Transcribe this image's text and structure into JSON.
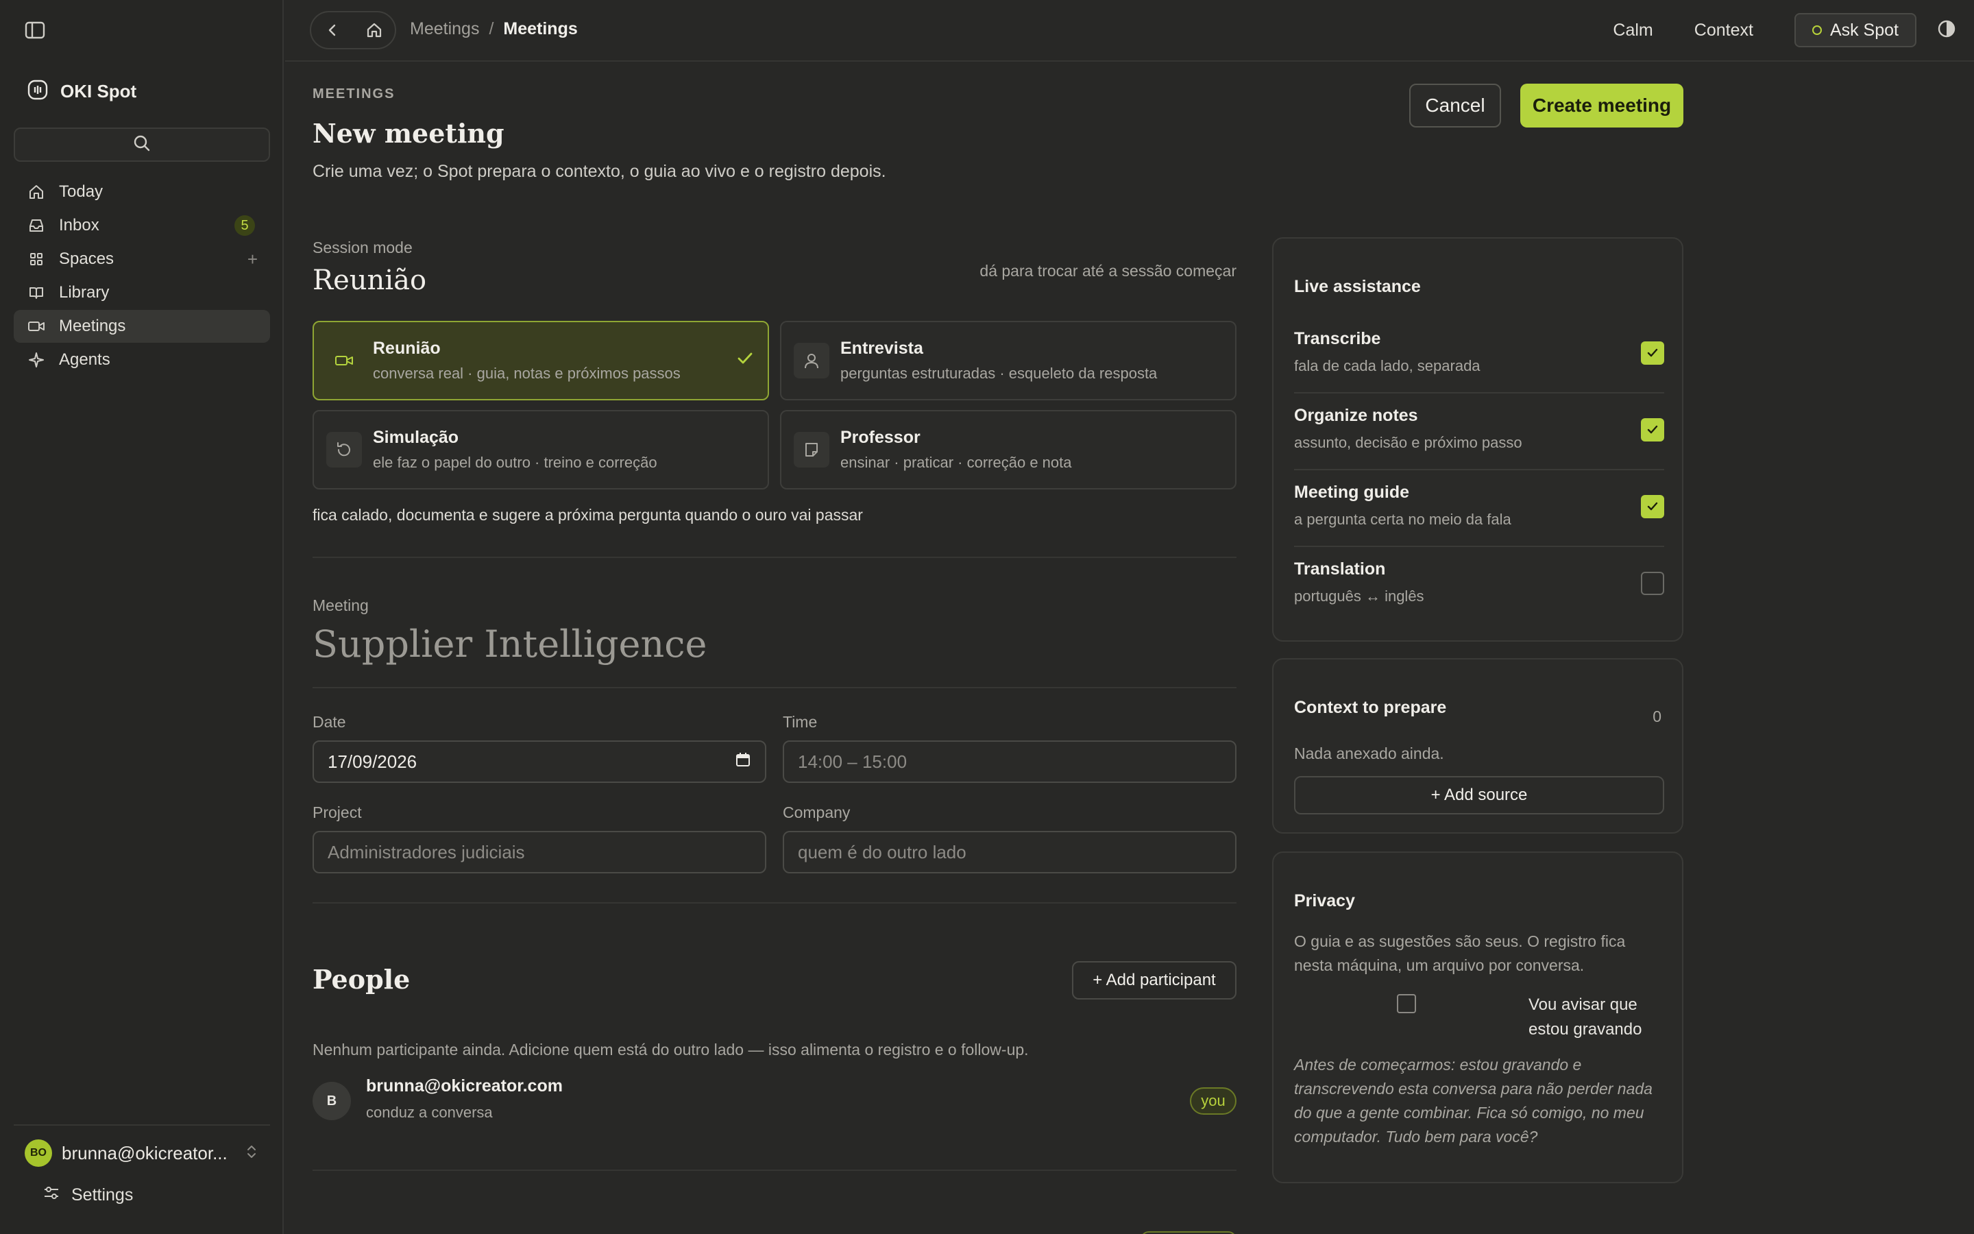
{
  "app": {
    "name": "OKI Spot"
  },
  "sidebar": {
    "search_placeholder": "",
    "items": [
      {
        "label": "Today",
        "icon": "home-icon"
      },
      {
        "label": "Inbox",
        "icon": "inbox-icon",
        "count": "5"
      },
      {
        "label": "Spaces",
        "icon": "grid-icon"
      },
      {
        "label": "Library",
        "icon": "book-icon"
      },
      {
        "label": "Meetings",
        "icon": "video-icon",
        "active": true
      },
      {
        "label": "Agents",
        "icon": "sparkle-icon"
      }
    ],
    "account": {
      "initials": "BO",
      "name": "brunna@okicreator..."
    },
    "settings_label": "Settings"
  },
  "topbar": {
    "breadcrumb": [
      "Meetings",
      "Meetings"
    ],
    "separator": "/",
    "links": [
      "Calm",
      "Context"
    ],
    "ask_label": "Ask Spot"
  },
  "page": {
    "kicker": "MEETINGS",
    "title": "New meeting",
    "subtitle": "Crie uma vez; o Spot prepara o contexto, o guia ao vivo e o registro depois.",
    "cancel_label": "Cancel",
    "create_label": "Create meeting"
  },
  "session": {
    "label": "Session mode",
    "current": "Reunião",
    "hint": "dá para trocar até a sessão começar",
    "modes": [
      {
        "name": "Reunião",
        "desc": "conversa real · guia, notas e próximos passos",
        "icon": "video-icon",
        "selected": true
      },
      {
        "name": "Entrevista",
        "desc": "perguntas estruturadas · esqueleto da resposta",
        "icon": "person-icon",
        "selected": false
      },
      {
        "name": "Simulação",
        "desc": "ele faz o papel do outro · treino e correção",
        "icon": "rotate-icon",
        "selected": false
      },
      {
        "name": "Professor",
        "desc": "ensinar · praticar · correção e nota",
        "icon": "note-icon",
        "selected": false
      }
    ],
    "note": "fica calado, documenta e sugere a próxima pergunta quando o ouro vai passar"
  },
  "meeting": {
    "label": "Meeting",
    "name_placeholder": "Supplier Intelligence",
    "date_label": "Date",
    "date_value": "17/09/2026",
    "time_label": "Time",
    "time_placeholder": "14:00 – 15:00",
    "project_label": "Project",
    "project_placeholder": "Administradores judiciais",
    "company_label": "Company",
    "company_placeholder": "quem é do outro lado"
  },
  "people": {
    "title": "People",
    "add_label": "+ Add participant",
    "empty_text": "Nenhum participante ainda. Adicione quem está do outro lado — isso alimenta o registro e o follow-up.",
    "participants": [
      {
        "initial": "B",
        "email": "brunna@okicreator.com",
        "role": "conduz a conversa",
        "badge": "you"
      }
    ]
  },
  "live_assistance": {
    "title": "Live assistance",
    "items": [
      {
        "name": "Transcribe",
        "desc": "fala de cada lado, separada",
        "checked": true
      },
      {
        "name": "Organize notes",
        "desc": "assunto, decisão e próximo passo",
        "checked": true
      },
      {
        "name": "Meeting guide",
        "desc": "a pergunta certa no meio da fala",
        "checked": true
      },
      {
        "name": "Translation",
        "desc": "português ↔ inglês",
        "checked": false
      }
    ]
  },
  "context": {
    "title": "Context to prepare",
    "count": "0",
    "empty": "Nada anexado ainda.",
    "add_label": "+ Add source"
  },
  "privacy": {
    "title": "Privacy",
    "text": "O guia e as sugestões são seus. O registro fica nesta máquina, um arquivo por conversa.",
    "checkbox_label": "Vou avisar que estou gravando",
    "quote": "Antes de começarmos: estou gravando e transcrevendo esta conversa para não perder nada do que a gente combinar. Fica só comigo, no meu computador. Tudo bem para você?"
  },
  "colors": {
    "accent": "#b4d33d",
    "background": "#282826",
    "sidebar": "#262624"
  }
}
